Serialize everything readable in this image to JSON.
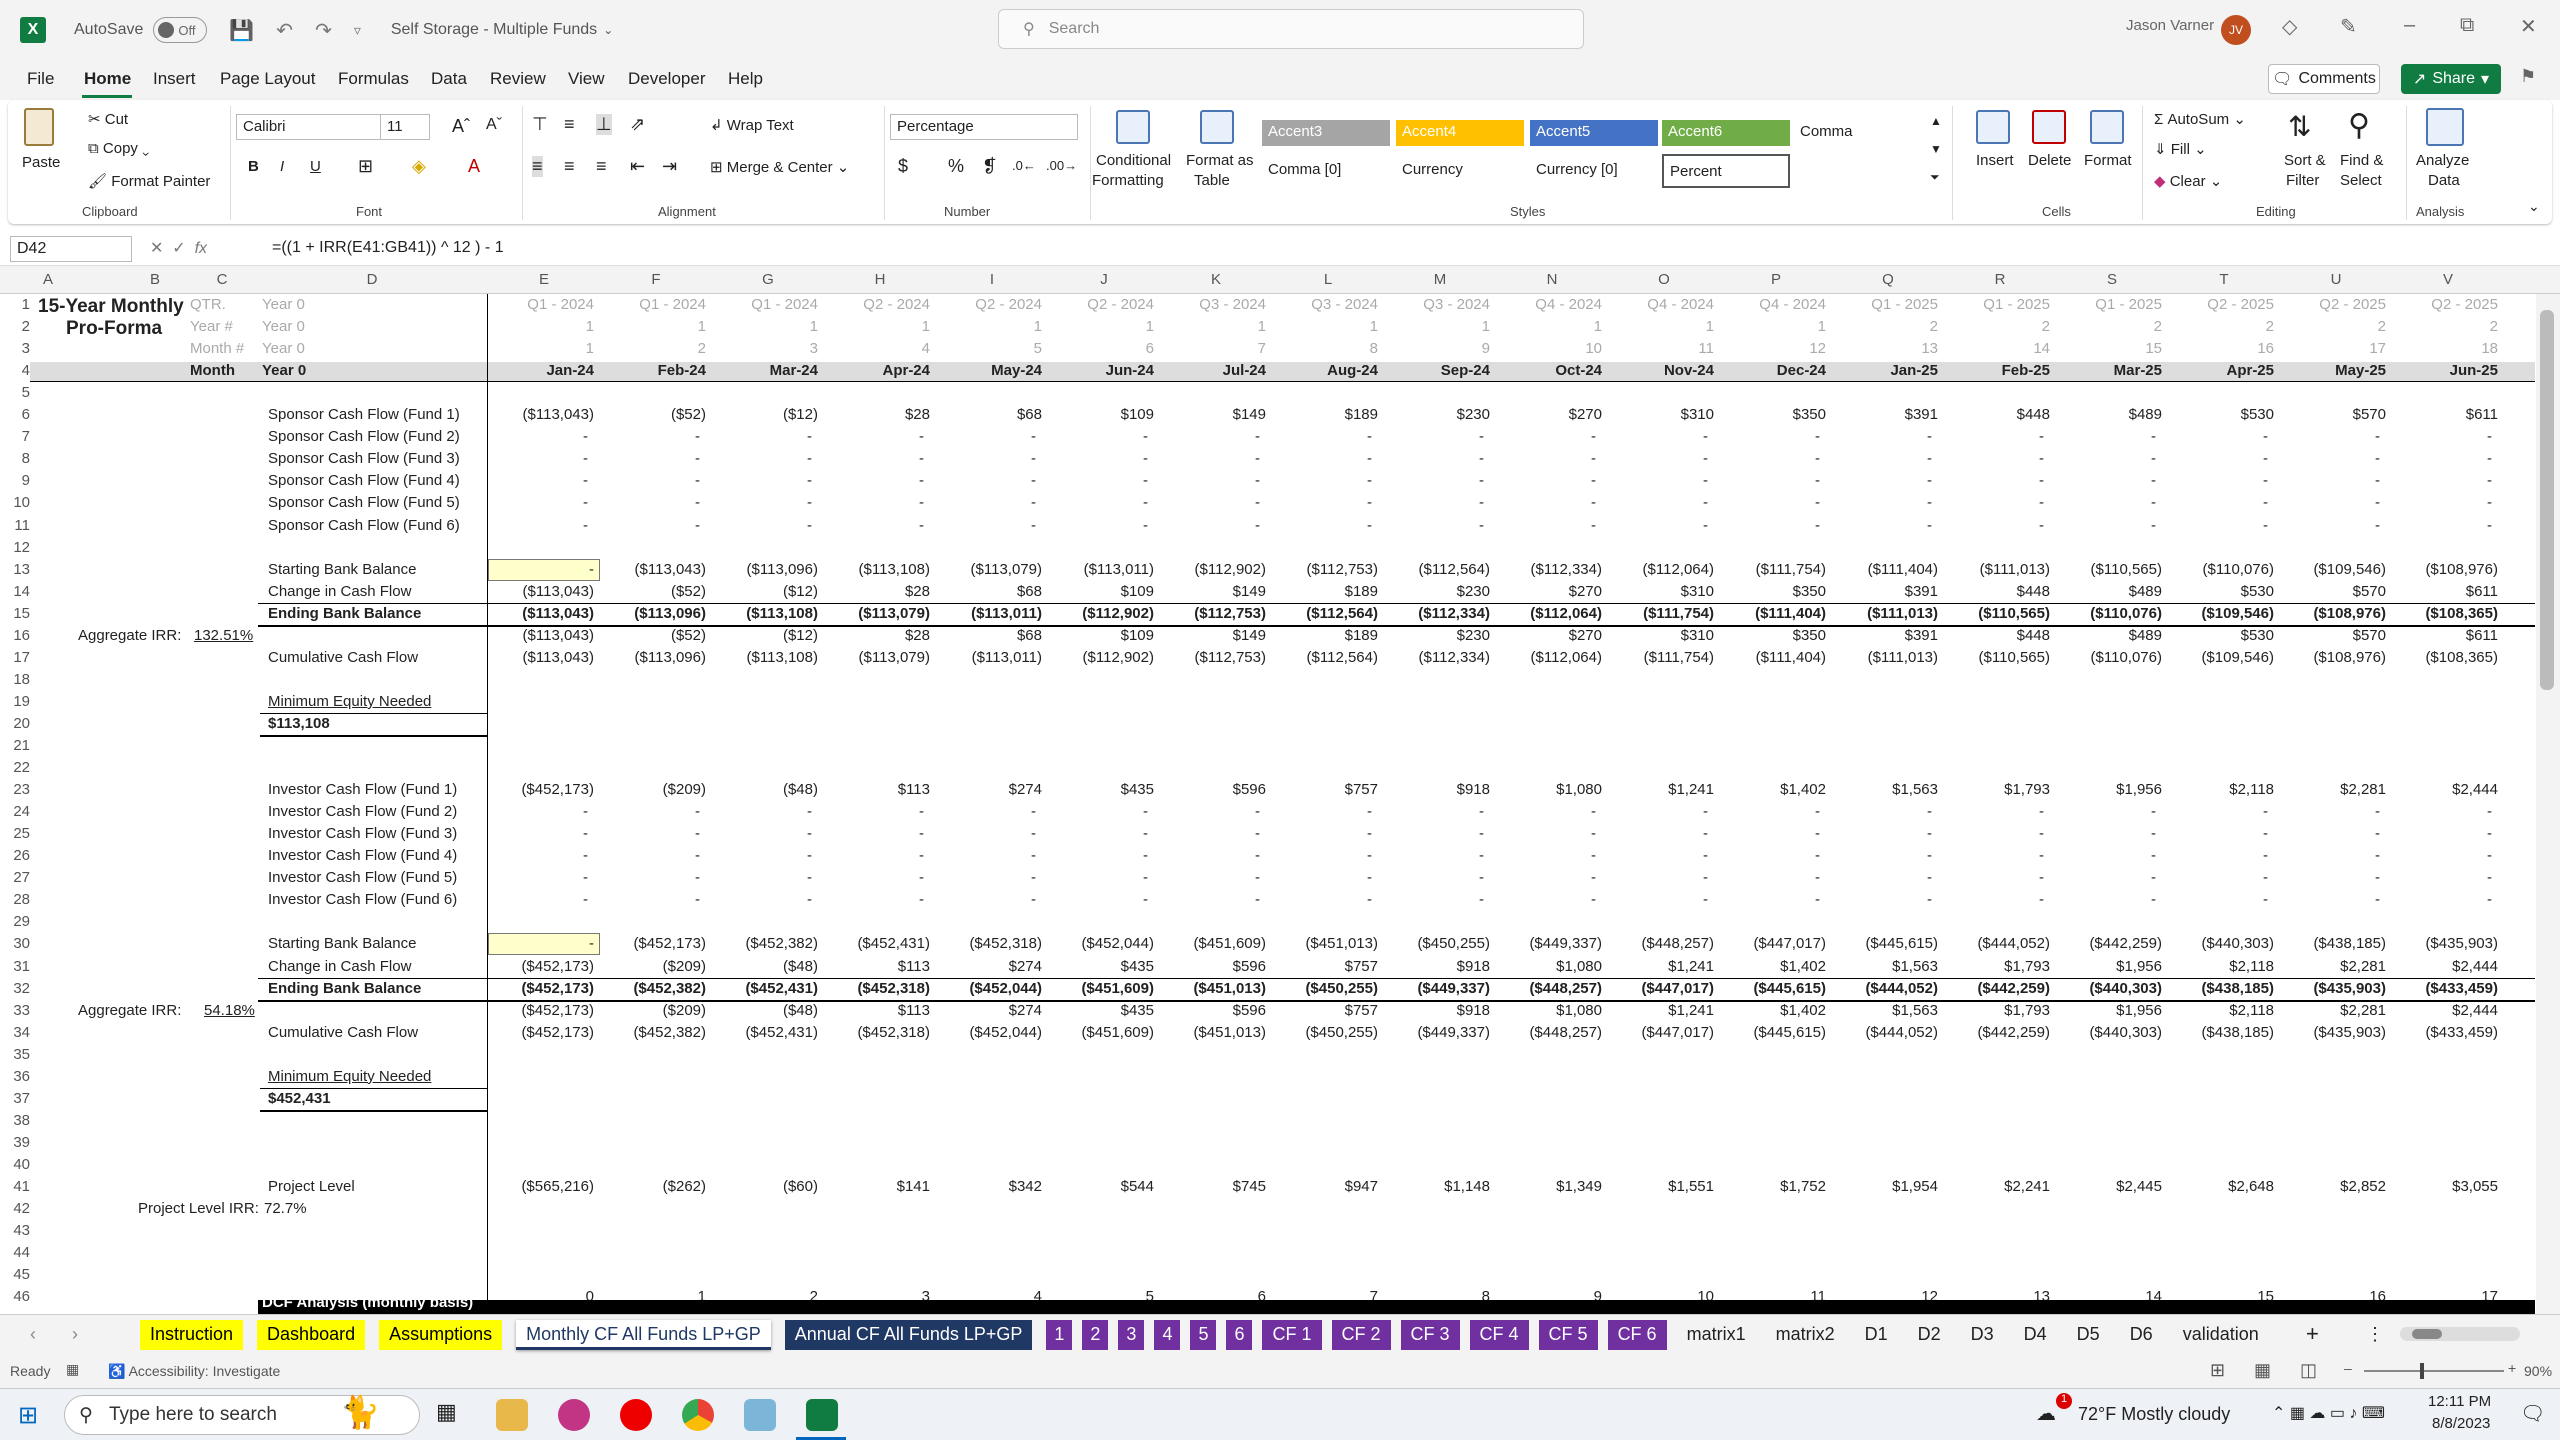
{
  "titlebar": {
    "autosave": "AutoSave",
    "toggle": "Off",
    "doc_title": "Self Storage - Multiple Funds",
    "user": "Jason Varner",
    "initials": "JV"
  },
  "search": {
    "placeholder": "Search"
  },
  "menu": [
    "File",
    "Home",
    "Insert",
    "Page Layout",
    "Formulas",
    "Data",
    "Review",
    "View",
    "Developer",
    "Help"
  ],
  "actions": {
    "comments": "Comments",
    "share": "Share"
  },
  "ribbon": {
    "clipboard": {
      "paste": "Paste",
      "cut": "Cut",
      "copy": "Copy",
      "painter": "Format Painter",
      "label": "Clipboard"
    },
    "font": {
      "name": "Calibri",
      "size": "11",
      "label": "Font"
    },
    "alignment": {
      "wrap": "Wrap Text",
      "merge": "Merge & Center",
      "label": "Alignment"
    },
    "number": {
      "format": "Percentage",
      "label": "Number"
    },
    "styles": {
      "cond": "Conditional",
      "cond2": "Formatting",
      "fmt": "Format as",
      "fmt2": "Table",
      "label": "Styles",
      "accent3": "Accent3",
      "accent4": "Accent4",
      "accent5": "Accent5",
      "accent6": "Accent6",
      "comma": "Comma",
      "comma0": "Comma [0]",
      "currency": "Currency",
      "currency0": "Currency [0]",
      "percent": "Percent"
    },
    "cells": {
      "insert": "Insert",
      "delete": "Delete",
      "format": "Format",
      "label": "Cells"
    },
    "editing": {
      "autosum": "AutoSum",
      "fill": "Fill",
      "clear": "Clear",
      "sort": "Sort &",
      "sort2": "Filter",
      "find": "Find &",
      "find2": "Select",
      "label": "Editing"
    },
    "analysis": {
      "analyze": "Analyze",
      "analyze2": "Data",
      "label": "Analysis"
    }
  },
  "formula_bar": {
    "cell": "D42",
    "formula": "=((1 + IRR(E41:GB41)) ^ 12 ) - 1"
  },
  "columns": [
    "A",
    "B",
    "C",
    "D",
    "E",
    "F",
    "G",
    "H",
    "I",
    "J",
    "K",
    "L",
    "M",
    "N",
    "O",
    "P",
    "Q",
    "R",
    "S",
    "T",
    "U",
    "V"
  ],
  "sheet": {
    "title1": "15-Year Monthly",
    "title2": "Pro-Forma",
    "qtr_label": "QTR.",
    "year_hash": "Year #",
    "month_hash": "Month #",
    "month": "Month",
    "year0": "Year 0",
    "quarters": [
      "Q1 - 2024",
      "Q1 - 2024",
      "Q1 - 2024",
      "Q2 - 2024",
      "Q2 - 2024",
      "Q2 - 2024",
      "Q3 - 2024",
      "Q3 - 2024",
      "Q3 - 2024",
      "Q4 - 2024",
      "Q4 - 2024",
      "Q4 - 2024",
      "Q1 - 2025",
      "Q1 - 2025",
      "Q1 - 2025",
      "Q2 - 2025",
      "Q2 - 2025",
      "Q2 - 2025"
    ],
    "years": [
      "1",
      "1",
      "1",
      "1",
      "1",
      "1",
      "1",
      "1",
      "1",
      "1",
      "1",
      "1",
      "2",
      "2",
      "2",
      "2",
      "2",
      "2"
    ],
    "months_num": [
      "1",
      "2",
      "3",
      "4",
      "5",
      "6",
      "7",
      "8",
      "9",
      "10",
      "11",
      "12",
      "13",
      "14",
      "15",
      "16",
      "17",
      "18"
    ],
    "months": [
      "Jan-24",
      "Feb-24",
      "Mar-24",
      "Apr-24",
      "May-24",
      "Jun-24",
      "Jul-24",
      "Aug-24",
      "Sep-24",
      "Oct-24",
      "Nov-24",
      "Dec-24",
      "Jan-25",
      "Feb-25",
      "Mar-25",
      "Apr-25",
      "May-25",
      "Jun-25"
    ],
    "sponsor_labels": [
      "Sponsor Cash Flow (Fund 1)",
      "Sponsor Cash Flow (Fund 2)",
      "Sponsor Cash Flow (Fund 3)",
      "Sponsor Cash Flow (Fund 4)",
      "Sponsor Cash Flow (Fund 5)",
      "Sponsor Cash Flow (Fund 6)"
    ],
    "investor_labels": [
      "Investor Cash Flow (Fund 1)",
      "Investor Cash Flow (Fund 2)",
      "Investor Cash Flow (Fund 3)",
      "Investor Cash Flow (Fund 4)",
      "Investor Cash Flow (Fund 5)",
      "Investor Cash Flow (Fund 6)"
    ],
    "dash": "-",
    "starting": "Starting Bank Balance",
    "change": "Change in Cash Flow",
    "ending": "Ending Bank Balance",
    "cumulative": "Cumulative Cash Flow",
    "min_equity": "Minimum Equity Needed",
    "agg_irr": "Aggregate IRR:",
    "sponsor_irr": "132.51%",
    "investor_irr": "54.18%",
    "sponsor_min": "$113,108",
    "investor_min": "$452,431",
    "project_level": "Project Level",
    "project_irr_label": "Project Level IRR:",
    "project_irr": "72.7%",
    "row46_d": "DCF Analysis (monthly basis)",
    "sponsor_f1": [
      "($113,043)",
      "($52)",
      "($12)",
      "$28",
      "$68",
      "$109",
      "$149",
      "$189",
      "$230",
      "$270",
      "$310",
      "$350",
      "$391",
      "$448",
      "$489",
      "$530",
      "$570",
      "$611"
    ],
    "sponsor_start": [
      "-",
      "($113,043)",
      "($113,096)",
      "($113,108)",
      "($113,079)",
      "($113,011)",
      "($112,902)",
      "($112,753)",
      "($112,564)",
      "($112,334)",
      "($112,064)",
      "($111,754)",
      "($111,404)",
      "($111,013)",
      "($110,565)",
      "($110,076)",
      "($109,546)",
      "($108,976)"
    ],
    "sponsor_end": [
      "($113,043)",
      "($113,096)",
      "($113,108)",
      "($113,079)",
      "($113,011)",
      "($112,902)",
      "($112,753)",
      "($112,564)",
      "($112,334)",
      "($112,064)",
      "($111,754)",
      "($111,404)",
      "($111,013)",
      "($110,565)",
      "($110,076)",
      "($109,546)",
      "($108,976)",
      "($108,365)"
    ],
    "investor_f1": [
      "($452,173)",
      "($209)",
      "($48)",
      "$113",
      "$274",
      "$435",
      "$596",
      "$757",
      "$918",
      "$1,080",
      "$1,241",
      "$1,402",
      "$1,563",
      "$1,793",
      "$1,956",
      "$2,118",
      "$2,281",
      "$2,444"
    ],
    "investor_start": [
      "-",
      "($452,173)",
      "($452,382)",
      "($452,431)",
      "($452,318)",
      "($452,044)",
      "($451,609)",
      "($451,013)",
      "($450,255)",
      "($449,337)",
      "($448,257)",
      "($447,017)",
      "($445,615)",
      "($444,052)",
      "($442,259)",
      "($440,303)",
      "($438,185)",
      "($435,903)"
    ],
    "investor_end": [
      "($452,173)",
      "($452,382)",
      "($452,431)",
      "($452,318)",
      "($452,044)",
      "($451,609)",
      "($451,013)",
      "($450,255)",
      "($449,337)",
      "($448,257)",
      "($447,017)",
      "($445,615)",
      "($444,052)",
      "($442,259)",
      "($440,303)",
      "($438,185)",
      "($435,903)",
      "($433,459)"
    ],
    "project": [
      "($565,216)",
      "($262)",
      "($60)",
      "$141",
      "$342",
      "$544",
      "$745",
      "$947",
      "$1,148",
      "$1,349",
      "$1,551",
      "$1,752",
      "$1,954",
      "$2,241",
      "$2,445",
      "$2,648",
      "$2,852",
      "$3,055"
    ],
    "periods": [
      "0",
      "1",
      "2",
      "3",
      "4",
      "5",
      "6",
      "7",
      "8",
      "9",
      "10",
      "11",
      "12",
      "13",
      "14",
      "15",
      "16",
      "17"
    ]
  },
  "tabs": [
    "Instruction",
    "Dashboard",
    "Assumptions",
    "Monthly CF All Funds LP+GP",
    "Annual CF All Funds LP+GP",
    "1",
    "2",
    "3",
    "4",
    "5",
    "6",
    "CF 1",
    "CF 2",
    "CF 3",
    "CF 4",
    "CF 5",
    "CF 6",
    "matrix1",
    "matrix2",
    "D1",
    "D2",
    "D3",
    "D4",
    "D5",
    "D6",
    "validation"
  ],
  "status": {
    "ready": "Ready",
    "access": "Accessibility: Investigate",
    "zoom": "90%"
  },
  "taskbar": {
    "search": "Type here to search",
    "weather": "72°F  Mostly cloudy",
    "time": "12:11 PM",
    "date": "8/8/2023",
    "badge": "1"
  },
  "colors": {
    "excel_green": "#107c41",
    "accent3": "#a5a5a5",
    "accent4": "#ffc000",
    "accent5": "#4472c4",
    "accent6": "#70ad47",
    "tab_yellow": "#ffff00",
    "tab_navy": "#203864",
    "tab_purple": "#7030a0"
  }
}
